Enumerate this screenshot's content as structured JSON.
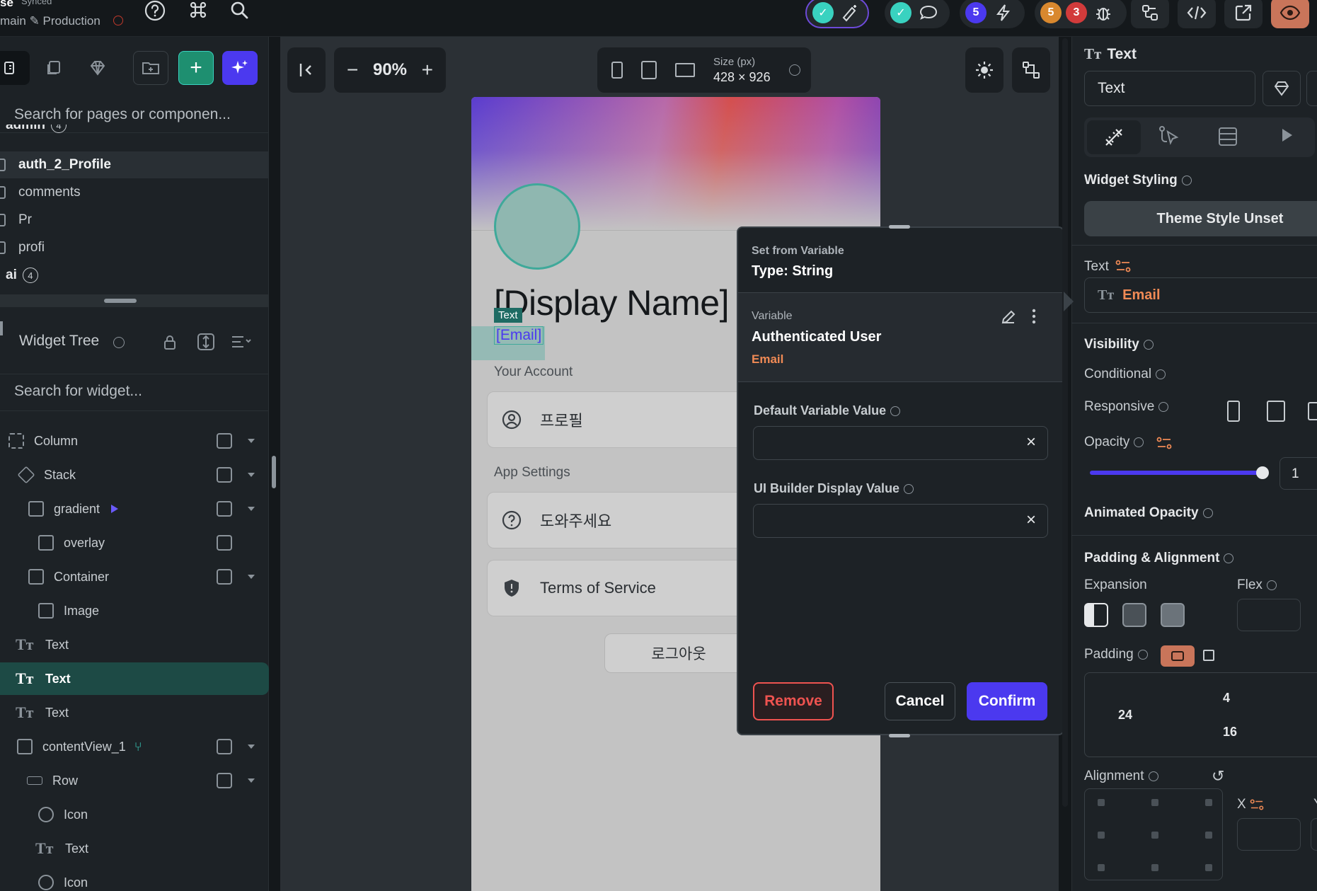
{
  "topbar": {
    "project": "se",
    "synced": "Synced",
    "branch": "main ✎ Production",
    "badge_a": "5",
    "badge_b": "5",
    "badge_c": "3"
  },
  "left": {
    "search_placeholder": "Search for pages or componen...",
    "pages": [
      {
        "label": "admin",
        "count": "4"
      },
      {
        "label": "auth_2_Profile"
      },
      {
        "label": "comments"
      },
      {
        "label": "Pr"
      },
      {
        "label": "profi"
      },
      {
        "label": "ai",
        "count": "4"
      }
    ],
    "widget_tree_title": "Widget Tree",
    "widget_search_placeholder": "Search for widget...",
    "tree": [
      {
        "label": "Column"
      },
      {
        "label": "Stack"
      },
      {
        "label": "gradient"
      },
      {
        "label": "overlay"
      },
      {
        "label": "Container"
      },
      {
        "label": "Image"
      },
      {
        "label": "Text"
      },
      {
        "label": "Text"
      },
      {
        "label": "Text"
      },
      {
        "label": "contentView_1"
      },
      {
        "label": "Row"
      },
      {
        "label": "Icon"
      },
      {
        "label": "Text"
      },
      {
        "label": "Icon"
      }
    ]
  },
  "canvas": {
    "zoom": "90%",
    "size_label": "Size (px)",
    "size_value": "428 × 926",
    "display_name": "[Display Name]",
    "selected_tag": "Text",
    "email": "[Email]",
    "your_account": "Your Account",
    "profile": "프로필",
    "app_settings": "App Settings",
    "help": "도와주세요",
    "tos": "Terms of Service",
    "logout": "로그아웃"
  },
  "popup": {
    "header_small": "Set from Variable",
    "header_type": "Type: String",
    "variable_label": "Variable",
    "variable_name": "Authenticated User",
    "variable_field": "Email",
    "default_label": "Default Variable Value",
    "default_value": "",
    "ui_label": "UI Builder Display Value",
    "ui_value": "",
    "remove": "Remove",
    "cancel": "Cancel",
    "confirm": "Confirm"
  },
  "right": {
    "title": "Text",
    "name_value": "Text",
    "widget_styling": "Widget Styling",
    "theme_style": "Theme Style Unset",
    "text_label": "Text",
    "text_value": "Email",
    "visibility": "Visibility",
    "conditional": "Conditional",
    "responsive": "Responsive",
    "opacity": "Opacity",
    "opacity_value": "1",
    "animated_opacity": "Animated Opacity",
    "padding_alignment": "Padding & Alignment",
    "expansion": "Expansion",
    "flex": "Flex",
    "padding": "Padding",
    "pad_top": "4",
    "pad_left": "24",
    "pad_bottom": "16",
    "alignment": "Alignment",
    "x_label": "X",
    "y_label": "Y"
  },
  "colors": {
    "accent": "#4b39ef",
    "teal": "#39d2c0",
    "danger": "#ef5350",
    "orange": "#f08a55"
  }
}
